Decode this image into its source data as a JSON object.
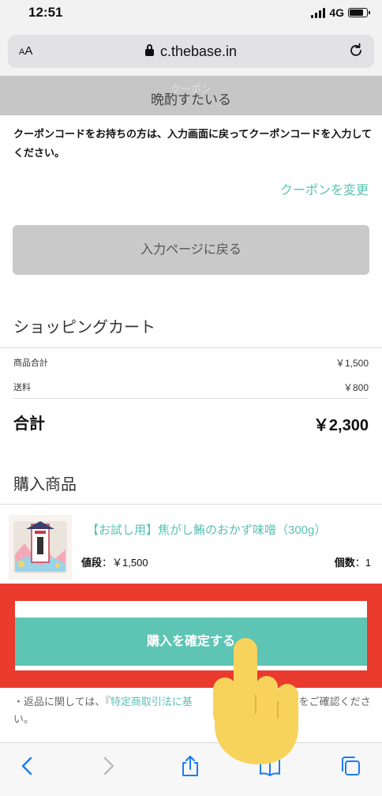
{
  "status": {
    "time": "12:51",
    "network": "4G"
  },
  "browser": {
    "text_size_label": "AA",
    "url": "c.thebase.in"
  },
  "coupon": {
    "header_label": "クーポン",
    "name": "晩酌すたいる",
    "note": "クーポンコードをお持ちの方は、入力画面に戻ってクーポンコードを入力してください。",
    "change_label": "クーポンを変更"
  },
  "back_button_label": "入力ページに戻る",
  "cart": {
    "title": "ショッピングカート",
    "subtotal_label": "商品合計",
    "subtotal_value": "￥1,500",
    "shipping_label": "送料",
    "shipping_value": "￥800",
    "total_label": "合計",
    "total_value": "￥2,300"
  },
  "items": {
    "title": "購入商品",
    "product_name": "【お試し用】焦がし鮪のおかず味噌（300g）",
    "price_label": "値段",
    "price_value": "：￥1,500",
    "qty_label": "個数",
    "qty_value": "：1"
  },
  "confirm_button_label": "購入を確定する",
  "footer_note": {
    "prefix": "・返品に関しては、『",
    "link": "特定商取引法に基",
    "suffix": "ページをご確認ください。"
  },
  "colors": {
    "accent": "#5ec4b4",
    "highlight": "#ea3a2d",
    "link": "#58c2b2"
  },
  "icons": [
    "lock-icon",
    "reload-icon",
    "back-icon",
    "forward-icon",
    "share-icon",
    "bookmarks-icon",
    "tabs-icon",
    "pointing-hand-icon"
  ]
}
